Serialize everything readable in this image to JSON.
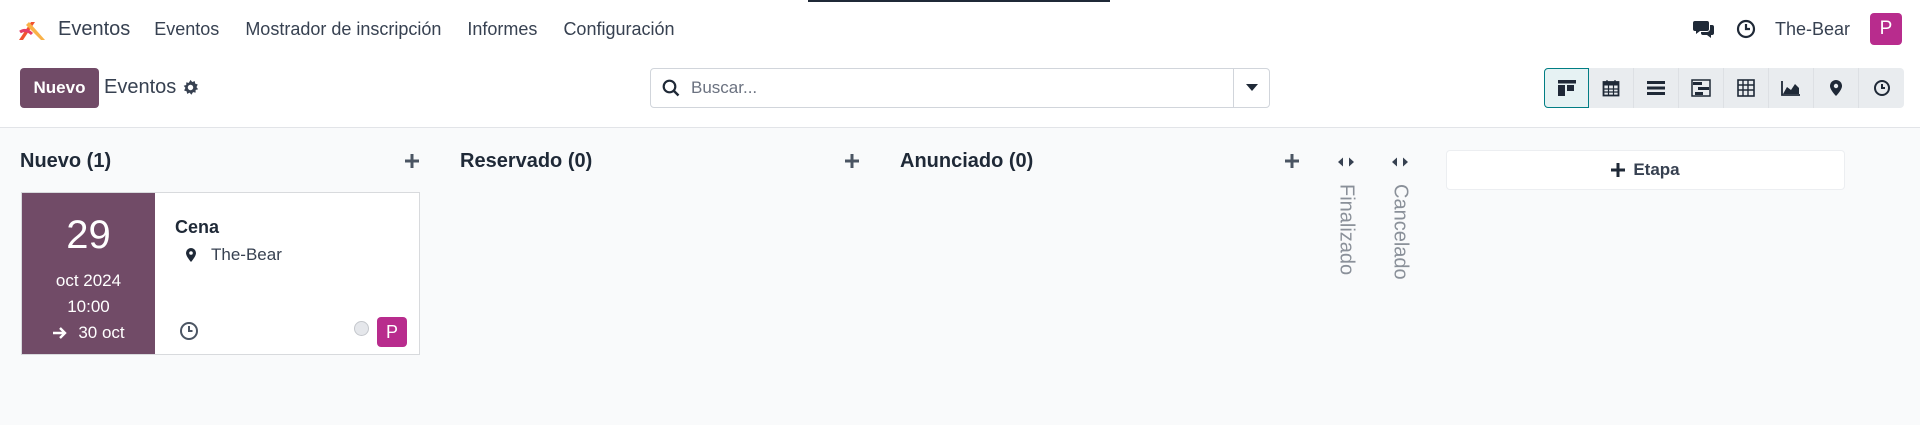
{
  "navbar": {
    "app_name": "Eventos",
    "menu": [
      "Eventos",
      "Mostrador de inscripción",
      "Informes",
      "Configuración"
    ],
    "company": "The-Bear",
    "user_initial": "P",
    "avatar_color": "#b82c8d"
  },
  "control_panel": {
    "new_label": "Nuevo",
    "breadcrumb": "Eventos",
    "search_placeholder": "Buscar...",
    "views": [
      "kanban-icon",
      "calendar-icon",
      "list-icon",
      "gantt-icon",
      "pivot-icon",
      "graph-icon",
      "map-icon",
      "activity-icon"
    ],
    "active_view": "kanban-icon",
    "accent_color": "#714b67"
  },
  "kanban": {
    "columns": [
      {
        "title": "Nuevo (1)"
      },
      {
        "title": "Reservado (0)"
      },
      {
        "title": "Anunciado (0)"
      }
    ],
    "folded": [
      "Finalizado",
      "Cancelado"
    ],
    "add_stage_label": "Etapa",
    "card": {
      "day": "29",
      "month_year": "oct 2024",
      "time": "10:00",
      "end_date": "30 oct",
      "title": "Cena",
      "location": "The-Bear",
      "user_initial": "P"
    }
  }
}
